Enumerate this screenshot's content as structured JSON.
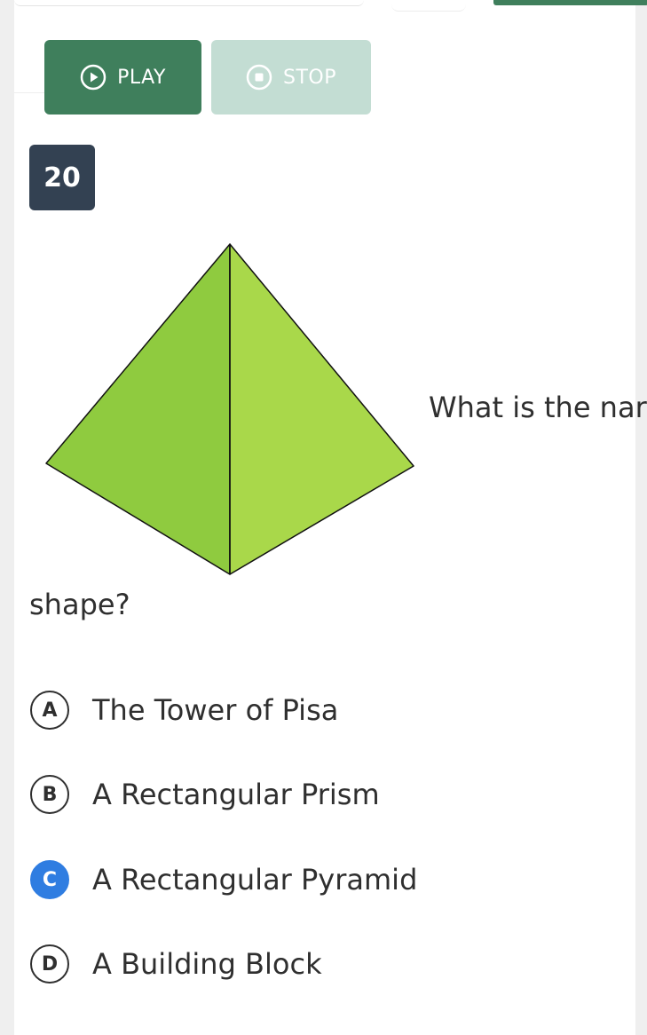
{
  "controls": {
    "play_label": "PLAY",
    "play_icon": "play-circle-icon",
    "stop_label": "STOP",
    "stop_icon": "stop-circle-icon",
    "play_color": "#3f7f5c",
    "stop_color": "#c3ddd3"
  },
  "question": {
    "number": "20",
    "text_part1": "What is the nar",
    "text_part2": "shape?",
    "image": "green-pyramid-illustration"
  },
  "options": [
    {
      "letter": "A",
      "label": "The Tower of Pisa",
      "selected": false
    },
    {
      "letter": "B",
      "label": "A Rectangular Prism",
      "selected": false
    },
    {
      "letter": "C",
      "label": "A Rectangular Pyramid",
      "selected": true
    },
    {
      "letter": "D",
      "label": "A Building Block",
      "selected": false
    }
  ],
  "colors": {
    "selected_badge": "#2f7de1",
    "question_number_bg": "#334152",
    "pyramid_left_face": "#8fcb3f",
    "pyramid_right_face": "#a9d84a"
  }
}
